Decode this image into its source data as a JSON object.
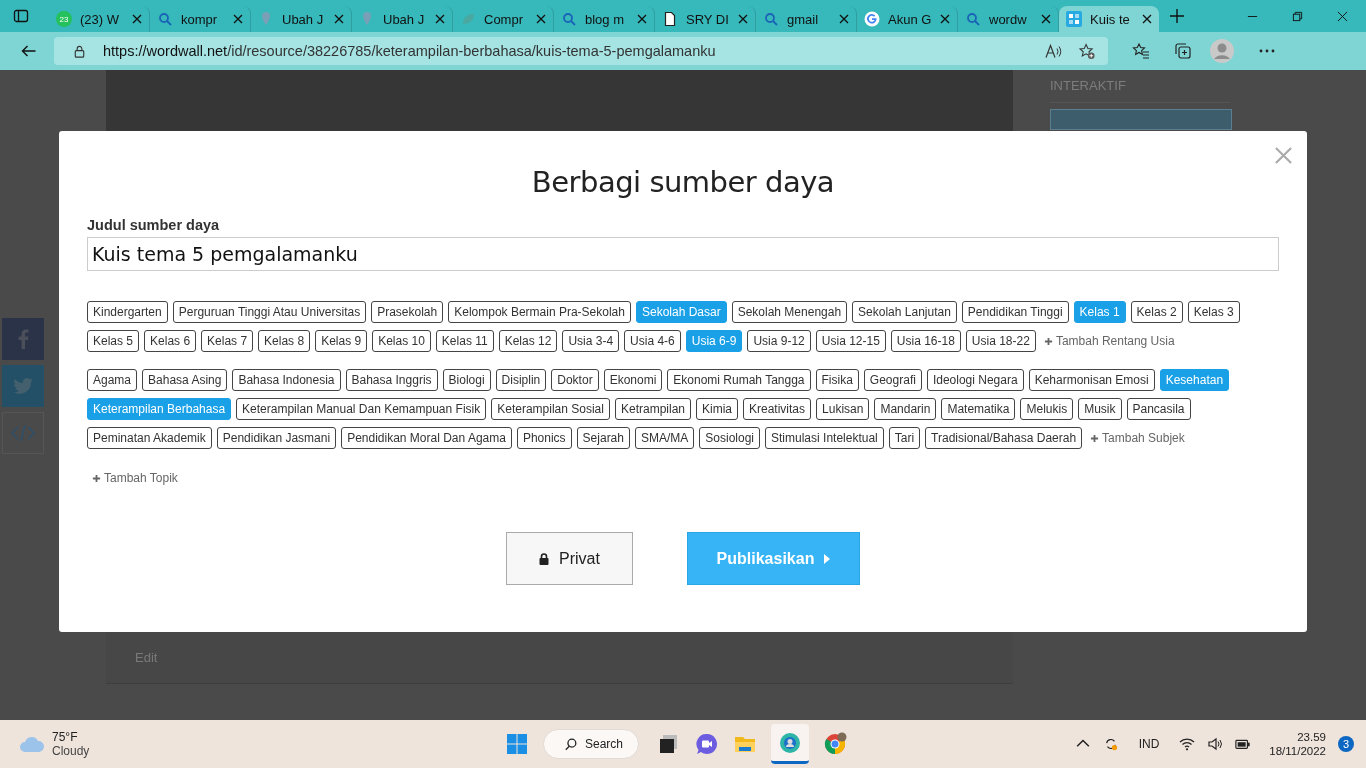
{
  "browser": {
    "tabs": [
      {
        "title": "(23) W",
        "kind": "whatsapp",
        "badge": "23",
        "selected": false
      },
      {
        "title": "kompr",
        "kind": "search",
        "selected": false
      },
      {
        "title": "Ubah J",
        "kind": "pin",
        "selected": false
      },
      {
        "title": "Ubah J",
        "kind": "pin",
        "selected": false
      },
      {
        "title": "Compr",
        "kind": "leaf",
        "selected": false
      },
      {
        "title": "blog m",
        "kind": "search",
        "selected": false
      },
      {
        "title": "SRY DI",
        "kind": "doc",
        "selected": false
      },
      {
        "title": "gmail",
        "kind": "search",
        "selected": false
      },
      {
        "title": "Akun G",
        "kind": "google",
        "selected": false
      },
      {
        "title": "wordw",
        "kind": "search",
        "selected": false
      },
      {
        "title": "Kuis te",
        "kind": "grid",
        "selected": true
      }
    ],
    "url_host": "https://wordwall.net",
    "url_path": "/id/resource/38226785/keterampilan-berbahasa/kuis-tema-5-pemgalamanku"
  },
  "page": {
    "sidebar_heading": "INTERAKTIF",
    "edit_link": "Edit"
  },
  "modal": {
    "title": "Berbagi sumber daya",
    "field_label": "Judul sumber daya",
    "field_value": "Kuis tema 5 pemgalamanku",
    "groups": [
      {
        "tags": [
          {
            "label": "Kindergarten",
            "selected": false
          },
          {
            "label": "Perguruan Tinggi Atau Universitas",
            "selected": false
          },
          {
            "label": "Prasekolah",
            "selected": false
          },
          {
            "label": "Kelompok Bermain Pra-Sekolah",
            "selected": false
          },
          {
            "label": "Sekolah Dasar",
            "selected": true
          },
          {
            "label": "Sekolah Menengah",
            "selected": false
          },
          {
            "label": "Sekolah Lanjutan",
            "selected": false
          },
          {
            "label": "Pendidikan Tinggi",
            "selected": false
          },
          {
            "label": "Kelas 1",
            "selected": true
          },
          {
            "label": "Kelas 2",
            "selected": false
          },
          {
            "label": "Kelas 3",
            "selected": false
          },
          {
            "label": "Kelas 5",
            "selected": false
          },
          {
            "label": "Kelas 6",
            "selected": false
          },
          {
            "label": "Kelas 7",
            "selected": false
          },
          {
            "label": "Kelas 8",
            "selected": false
          },
          {
            "label": "Kelas 9",
            "selected": false
          },
          {
            "label": "Kelas 10",
            "selected": false
          },
          {
            "label": "Kelas 11",
            "selected": false
          },
          {
            "label": "Kelas 12",
            "selected": false
          },
          {
            "label": "Usia 3-4",
            "selected": false
          },
          {
            "label": "Usia 4-6",
            "selected": false
          },
          {
            "label": "Usia 6-9",
            "selected": true
          },
          {
            "label": "Usia 9-12",
            "selected": false
          },
          {
            "label": "Usia 12-15",
            "selected": false
          },
          {
            "label": "Usia 16-18",
            "selected": false
          },
          {
            "label": "Usia 18-22",
            "selected": false
          }
        ],
        "add_link": "Tambah Rentang Usia"
      },
      {
        "tags": [
          {
            "label": "Agama",
            "selected": false
          },
          {
            "label": "Bahasa Asing",
            "selected": false
          },
          {
            "label": "Bahasa Indonesia",
            "selected": false
          },
          {
            "label": "Bahasa Inggris",
            "selected": false
          },
          {
            "label": "Biologi",
            "selected": false
          },
          {
            "label": "Disiplin",
            "selected": false
          },
          {
            "label": "Doktor",
            "selected": false
          },
          {
            "label": "Ekonomi",
            "selected": false
          },
          {
            "label": "Ekonomi Rumah Tangga",
            "selected": false
          },
          {
            "label": "Fisika",
            "selected": false
          },
          {
            "label": "Geografi",
            "selected": false
          },
          {
            "label": "Ideologi Negara",
            "selected": false
          },
          {
            "label": "Keharmonisan Emosi",
            "selected": false
          },
          {
            "label": "Kesehatan",
            "selected": true
          },
          {
            "label": "Keterampilan Berbahasa",
            "selected": true
          },
          {
            "label": "Keterampilan Manual Dan Kemampuan Fisik",
            "selected": false
          },
          {
            "label": "Keterampilan Sosial",
            "selected": false
          },
          {
            "label": "Ketrampilan",
            "selected": false
          },
          {
            "label": "Kimia",
            "selected": false
          },
          {
            "label": "Kreativitas",
            "selected": false
          },
          {
            "label": "Lukisan",
            "selected": false
          },
          {
            "label": "Mandarin",
            "selected": false
          },
          {
            "label": "Matematika",
            "selected": false
          },
          {
            "label": "Melukis",
            "selected": false
          },
          {
            "label": "Musik",
            "selected": false
          },
          {
            "label": "Pancasila",
            "selected": false
          },
          {
            "label": "Peminatan Akademik",
            "selected": false
          },
          {
            "label": "Pendidikan Jasmani",
            "selected": false
          },
          {
            "label": "Pendidikan Moral Dan Agama",
            "selected": false
          },
          {
            "label": "Phonics",
            "selected": false
          },
          {
            "label": "Sejarah",
            "selected": false
          },
          {
            "label": "SMA/MA",
            "selected": false
          },
          {
            "label": "Sosiologi",
            "selected": false
          },
          {
            "label": "Stimulasi Intelektual",
            "selected": false
          },
          {
            "label": "Tari",
            "selected": false
          },
          {
            "label": "Tradisional/Bahasa Daerah",
            "selected": false
          }
        ],
        "add_link": "Tambah Subjek"
      }
    ],
    "topic_link": "Tambah Topik",
    "private_button": "Privat",
    "publish_button": "Publikasikan"
  },
  "taskbar": {
    "temperature": "75°F",
    "weather": "Cloudy",
    "search": "Search",
    "language": "IND",
    "time": "23.59",
    "date": "18/11/2022",
    "notifications": "3"
  }
}
